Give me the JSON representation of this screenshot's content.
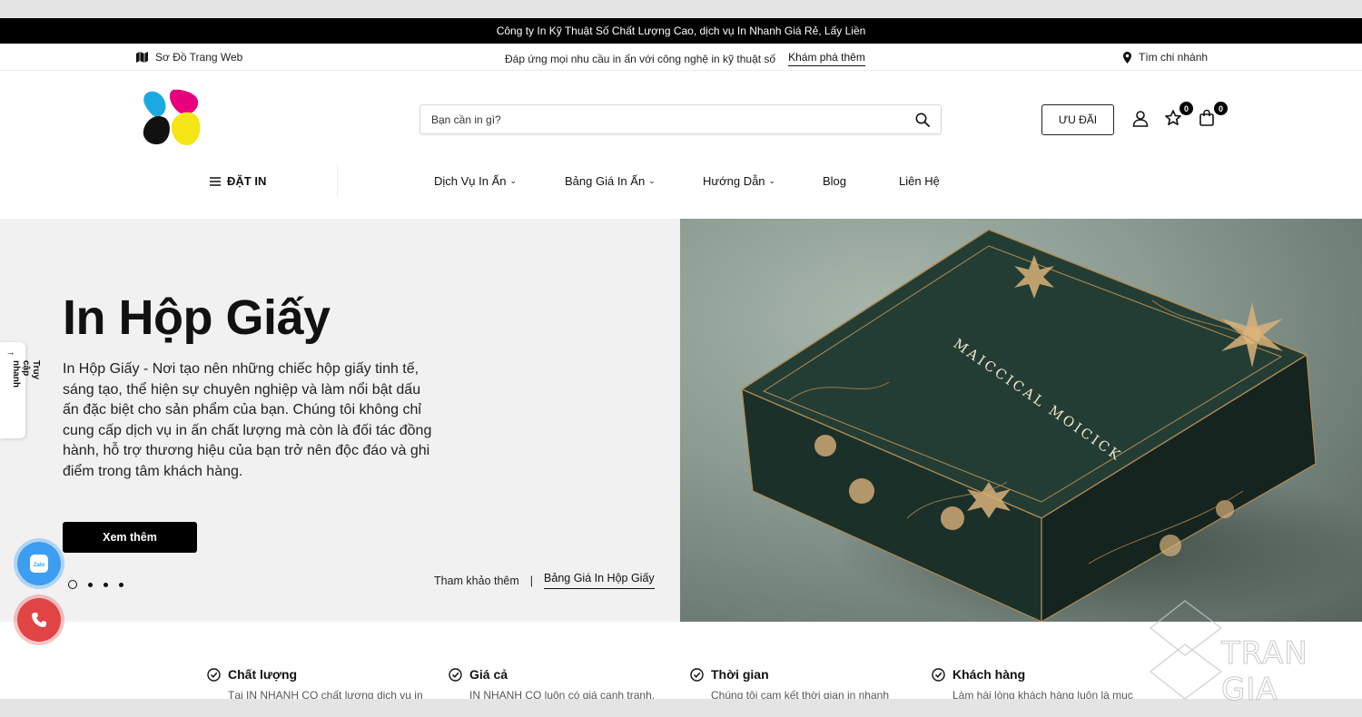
{
  "promo_bar": {
    "text": "Công ty In Kỹ Thuật Số Chất Lượng Cao, dịch vụ In Nhanh Giá Rẻ, Lấy Liền"
  },
  "top_bar": {
    "sitemap_label": "Sơ Đồ Trang Web",
    "tagline": "Đáp ứng mọi nhu cầu in ấn với công nghệ in kỹ thuật số",
    "explore_link": "Khám phá thêm",
    "branch_label": "Tìm chi nhánh"
  },
  "header": {
    "search_placeholder": "Bạn cần in gì?",
    "promo_button": "ƯU ĐÃI",
    "wishlist_count": "0",
    "cart_count": "0"
  },
  "nav": {
    "order_label": "ĐẶT IN",
    "items": [
      {
        "label": "Dịch Vụ In Ấn"
      },
      {
        "label": "Bảng Giá In Ấn"
      },
      {
        "label": "Hướng Dẫn"
      },
      {
        "label": "Blog"
      },
      {
        "label": "Liên Hệ"
      }
    ]
  },
  "hero": {
    "title": "In Hộp Giấy",
    "description": "In Hộp Giấy - Nơi tạo nên những chiếc hộp giấy tinh tế, sáng tạo, thể hiện sự chuyên nghiệp và làm nổi bật dấu ấn đặc biệt cho sản phẩm của bạn. Chúng tôi không chỉ cung cấp dịch vụ in ấn chất lượng mà còn là đối tác đồng hành, hỗ trợ thương hiệu của bạn trở nên độc đáo và ghi điểm trong tâm khách hàng.",
    "cta": "Xem thêm",
    "ref_label": "Tham khảo thêm",
    "ref_link": "Bảng Giá In Hộp Giấy",
    "slide_count": 4,
    "active_slide": 1,
    "box_text": "MAICCICAL MOICICK"
  },
  "side_tab": {
    "label": "Truy cập nhanh"
  },
  "float_buttons": {
    "zalo_label": "Zalo"
  },
  "features": [
    {
      "title": "Chất lượng",
      "desc": "Tại IN NHANH CO chất lượng dịch vụ in"
    },
    {
      "title": "Giá cả",
      "desc": "IN NHANH CO luôn có giá cạnh tranh,"
    },
    {
      "title": "Thời gian",
      "desc": "Chúng tôi cam kết thời gian in nhanh"
    },
    {
      "title": "Khách hàng",
      "desc": "Làm hài lòng khách hàng luôn là mục"
    }
  ],
  "watermark": {
    "text": "TRAN GIA"
  },
  "colors": {
    "accent": "#000000",
    "hero_bg": "#f1f1f1",
    "zalo": "#3d9df0",
    "phone": "#e04444"
  }
}
